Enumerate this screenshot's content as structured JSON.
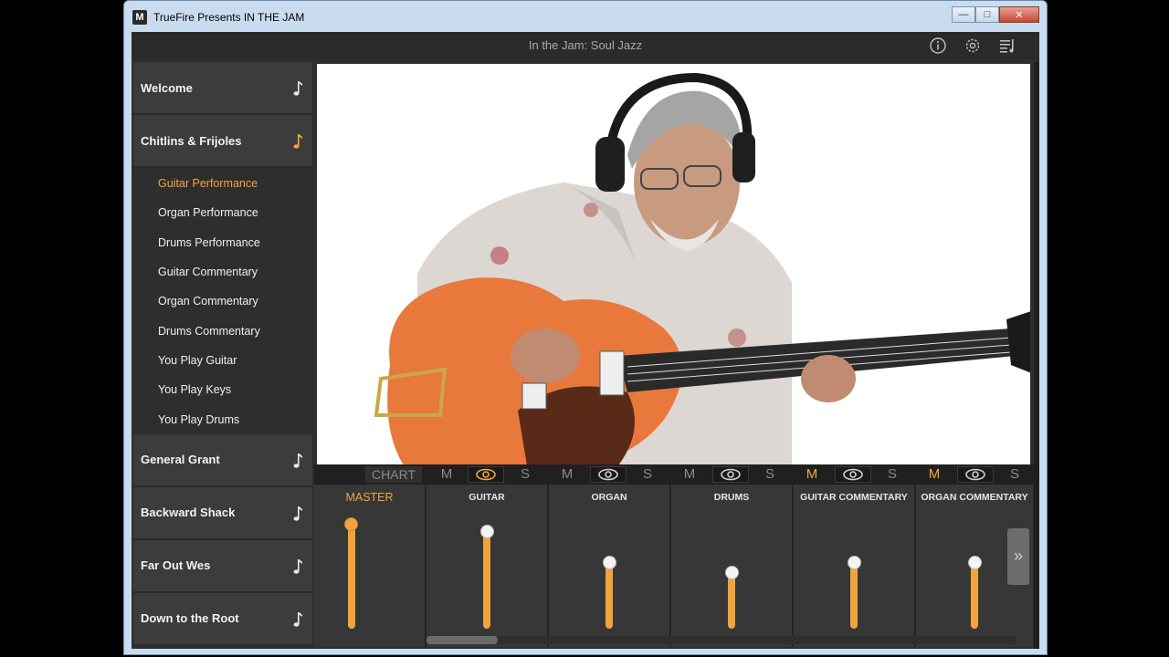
{
  "window": {
    "title": "TrueFire Presents IN THE JAM",
    "icon_letter": "M"
  },
  "header": {
    "title": "In the Jam: Soul Jazz",
    "icons": [
      "info-icon",
      "gear-icon",
      "playlist-icon"
    ]
  },
  "sidebar": {
    "songs_top": [
      {
        "label": "Welcome",
        "active": false
      },
      {
        "label": "Chitlins & Frijoles",
        "active": true
      }
    ],
    "subitems": [
      {
        "label": "Guitar Performance",
        "active": true
      },
      {
        "label": "Organ Performance",
        "active": false
      },
      {
        "label": "Drums Performance",
        "active": false
      },
      {
        "label": "Guitar Commentary",
        "active": false
      },
      {
        "label": "Organ Commentary",
        "active": false
      },
      {
        "label": "Drums Commentary",
        "active": false
      },
      {
        "label": "You Play Guitar",
        "active": false
      },
      {
        "label": "You Play Keys",
        "active": false
      },
      {
        "label": "You Play Drums",
        "active": false
      }
    ],
    "songs_bottom": [
      {
        "label": "General Grant"
      },
      {
        "label": "Backward Shack"
      },
      {
        "label": "Far Out Wes"
      },
      {
        "label": "Down to the Root"
      }
    ]
  },
  "mixer": {
    "chart_label": "CHART",
    "mute_label": "M",
    "solo_label": "S",
    "channels": [
      {
        "label": "MASTER",
        "level": 0.92,
        "mute_on": false
      },
      {
        "label": "GUITAR",
        "level": 0.85,
        "mute_on": false
      },
      {
        "label": "ORGAN",
        "level": 0.58,
        "mute_on": false
      },
      {
        "label": "DRUMS",
        "level": 0.49,
        "mute_on": false
      },
      {
        "label": "GUITAR COMMENTARY",
        "level": 0.58,
        "mute_on": true
      },
      {
        "label": "ORGAN COMMENTARY",
        "level": 0.58,
        "mute_on": true
      }
    ],
    "next_label": "»"
  },
  "colors": {
    "accent": "#f2a53e",
    "panel": "#3c3c3c",
    "background": "#2e2e2e"
  }
}
